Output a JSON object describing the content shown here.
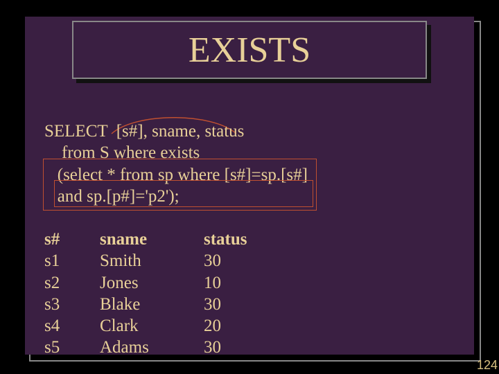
{
  "title": "EXISTS",
  "sql": {
    "l1": "SELECT  [s#], sname, status",
    "l2": "    from S where exists",
    "l3": "   (select * from sp where [s#]=sp.[s#]",
    "l4": "   and sp.[p#]='p2');"
  },
  "table": {
    "headers": {
      "c1": "s#",
      "c2": "sname",
      "c3": "status"
    },
    "rows": [
      {
        "c1": "s1",
        "c2": "Smith",
        "c3": "30"
      },
      {
        "c1": "s2",
        "c2": "Jones",
        "c3": "10"
      },
      {
        "c1": "s3",
        "c2": "Blake",
        "c3": "30"
      },
      {
        "c1": "s4",
        "c2": "Clark",
        "c3": "20"
      },
      {
        "c1": "s5",
        "c2": "Adams",
        "c3": "30"
      }
    ]
  },
  "page": "124",
  "chart_data": {
    "type": "table",
    "title": "EXISTS",
    "columns": [
      "s#",
      "sname",
      "status"
    ],
    "rows": [
      [
        "s1",
        "Smith",
        30
      ],
      [
        "s2",
        "Jones",
        10
      ],
      [
        "s3",
        "Blake",
        30
      ],
      [
        "s4",
        "Clark",
        20
      ],
      [
        "s5",
        "Adams",
        30
      ]
    ]
  }
}
